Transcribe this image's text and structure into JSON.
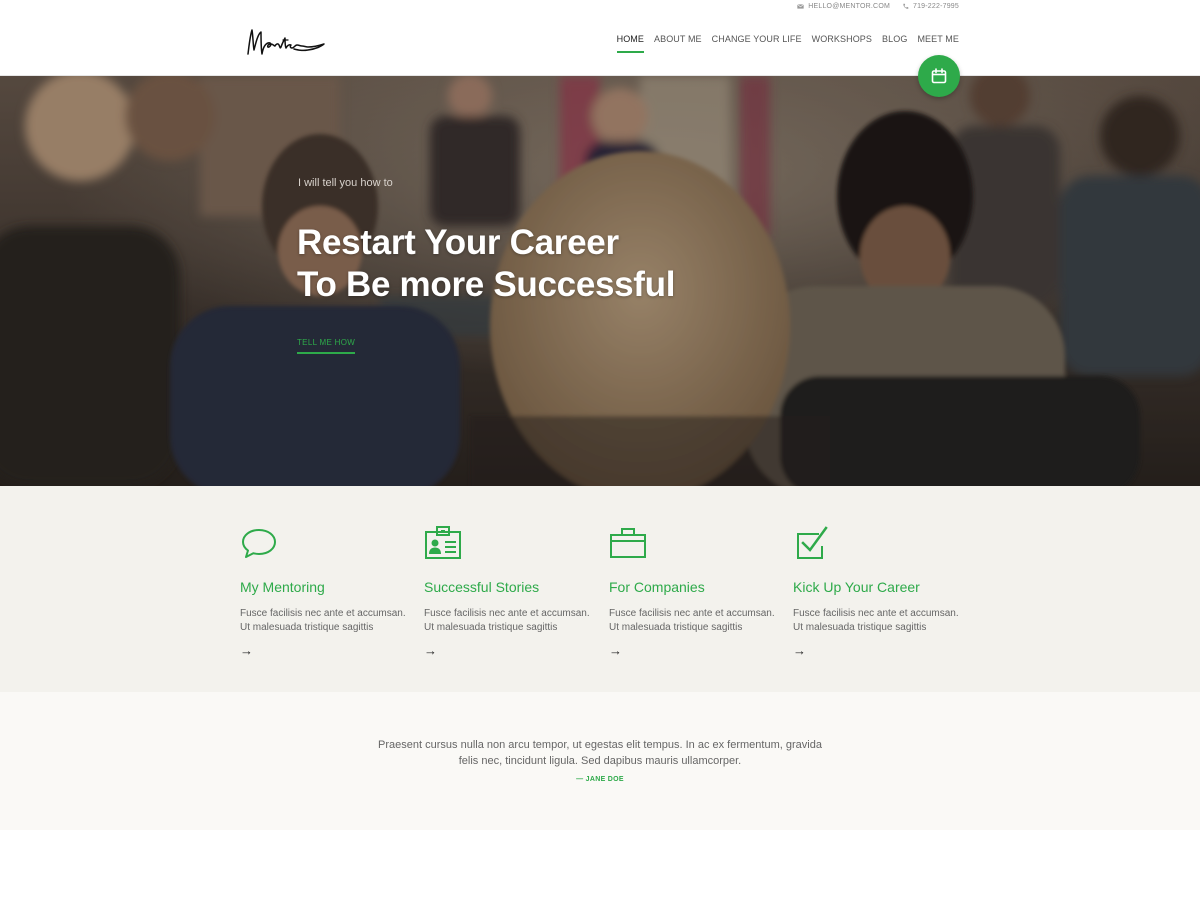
{
  "header": {
    "email": "HELLO@MENTOR.COM",
    "phone": "719-222-7995",
    "logo_text": "Mentor",
    "nav": [
      {
        "label": "HOME",
        "active": true
      },
      {
        "label": "ABOUT ME",
        "active": false
      },
      {
        "label": "CHANGE YOUR LIFE",
        "active": false
      },
      {
        "label": "WORKSHOPS",
        "active": false
      },
      {
        "label": "BLOG",
        "active": false
      },
      {
        "label": "MEET ME",
        "active": false
      }
    ]
  },
  "hero": {
    "subtitle": "I will tell you how to",
    "title_line1": "Restart Your Career",
    "title_line2": "To Be more Successful",
    "cta": "TELL ME HOW"
  },
  "features": [
    {
      "icon": "speech-bubble-icon",
      "title": "My Mentoring",
      "text": "Fusce facilisis nec ante et accumsan. Ut malesuada tristique sagittis",
      "arrow": "→"
    },
    {
      "icon": "id-card-icon",
      "title": "Successful Stories",
      "text": "Fusce facilisis nec ante et accumsan. Ut malesuada tristique sagittis",
      "arrow": "→"
    },
    {
      "icon": "briefcase-icon",
      "title": "For Companies",
      "text": "Fusce facilisis nec ante et accumsan. Ut malesuada tristique sagittis",
      "arrow": "→"
    },
    {
      "icon": "checkbox-icon",
      "title": "Kick Up Your Career",
      "text": "Fusce facilisis nec ante et accumsan. Ut malesuada tristique sagittis",
      "arrow": "→"
    }
  ],
  "testimonial": {
    "quote": "Praesent cursus nulla non arcu tempor, ut egestas elit tempus. In ac ex fermentum, gravida felis nec, tincidunt ligula. Sed dapibus mauris ullamcorper.",
    "author": "— JANE DOE"
  },
  "colors": {
    "accent": "#2eaa4a",
    "features_bg": "#f3f2ed",
    "testimonial_bg": "#faf9f6"
  }
}
